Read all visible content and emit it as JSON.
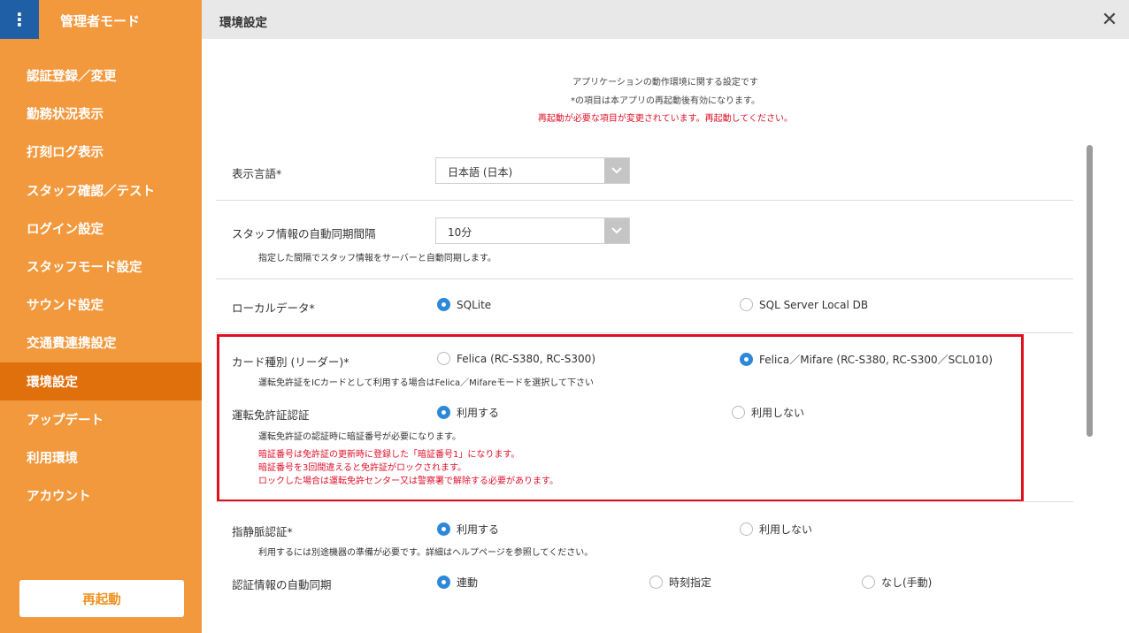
{
  "sidebar": {
    "menu_icon": "kebab-menu-icon",
    "title": "管理者モード",
    "items": [
      {
        "label": "認証登録／変更"
      },
      {
        "label": "勤務状況表示"
      },
      {
        "label": "打刻ログ表示"
      },
      {
        "label": "スタッフ確認／テスト"
      },
      {
        "label": "ログイン設定"
      },
      {
        "label": "スタッフモード設定"
      },
      {
        "label": "サウンド設定"
      },
      {
        "label": "交通費連携設定"
      },
      {
        "label": "環境設定"
      },
      {
        "label": "アップデート"
      },
      {
        "label": "利用環境"
      },
      {
        "label": "アカウント"
      }
    ],
    "restart_label": "再起動"
  },
  "header": {
    "title": "環境設定",
    "close_symbol": "✕"
  },
  "description": {
    "line1": "アプリケーションの動作環境に関する設定です",
    "line2": "*の項目は本アプリの再起動後有効になります。",
    "warning": "再起動が必要な項目が変更されています。再起動してください。"
  },
  "settings": {
    "language": {
      "label": "表示言語*",
      "value": "日本語 (日本)"
    },
    "sync_interval": {
      "label": "スタッフ情報の自動同期間隔",
      "value": "10分",
      "note": "指定した間隔でスタッフ情報をサーバーと自動同期します。"
    },
    "local_data": {
      "label": "ローカルデータ*",
      "options": [
        "SQLite",
        "SQL Server Local DB"
      ],
      "selected": 0
    },
    "card_type": {
      "label": "カード種別 (リーダー)*",
      "options": [
        "Felica (RC-S380, RC-S300)",
        "Felica／Mifare (RC-S380, RC-S300／SCL010)"
      ],
      "selected": 1,
      "note": "運転免許証をICカードとして利用する場合はFelica／Mifareモードを選択して下さい"
    },
    "license_auth": {
      "label": "運転免許証認証",
      "options": [
        "利用する",
        "利用しない"
      ],
      "selected": 0,
      "note": "運転免許証の認証時に暗証番号が必要になります。",
      "warnings": [
        "暗証番号は免許証の更新時に登録した「暗証番号1」になります。",
        "暗証番号を3回間違えると免許証がロックされます。",
        "ロックした場合は運転免許センター又は警察署で解除する必要があります。"
      ]
    },
    "vein_auth": {
      "label": "指静脈認証*",
      "options": [
        "利用する",
        "利用しない"
      ],
      "selected": 0,
      "note": "利用するには別途機器の準備が必要です。詳細はヘルプページを参照してください。"
    },
    "auth_sync": {
      "label": "認証情報の自動同期",
      "options": [
        "連動",
        "時刻指定",
        "なし(手動)"
      ],
      "selected": 0
    }
  },
  "colors": {
    "sidebar": "#f2993e",
    "sidebar_active": "#e0700c",
    "menu_button": "#1f5fa5",
    "radio_selected": "#2d88d8",
    "warning_text": "#e0102a",
    "highlight_border": "#e0101e"
  }
}
